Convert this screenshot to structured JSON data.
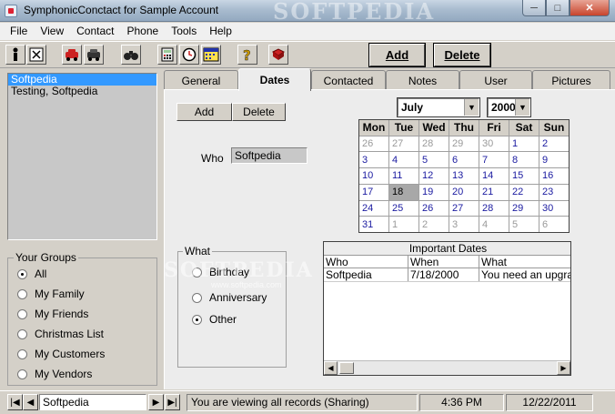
{
  "window": {
    "title": "SymphonicConctact for Sample Account",
    "watermark": "SOFTPEDIA"
  },
  "menu": [
    "File",
    "View",
    "Contact",
    "Phone",
    "Tools",
    "Help"
  ],
  "toolbar": {
    "add_label": "Add",
    "delete_label": "Delete",
    "icons": [
      "person-icon",
      "close-record-icon",
      "car-icon",
      "car-alt-icon",
      "binoculars-icon",
      "calculator-icon",
      "clock-icon",
      "calendar-icon",
      "help-icon",
      "book-icon"
    ]
  },
  "contacts": [
    {
      "name": "Softpedia",
      "selected": true
    },
    {
      "name": "Testing, Softpedia",
      "selected": false
    }
  ],
  "groups": {
    "title": "Your Groups",
    "items": [
      {
        "label": "All",
        "selected": true
      },
      {
        "label": "My Family",
        "selected": false
      },
      {
        "label": "My Friends",
        "selected": false
      },
      {
        "label": "Christmas List",
        "selected": false
      },
      {
        "label": "My Customers",
        "selected": false
      },
      {
        "label": "My Vendors",
        "selected": false
      }
    ]
  },
  "tabs": [
    {
      "label": "General",
      "active": false
    },
    {
      "label": "Dates",
      "active": true
    },
    {
      "label": "Contacted",
      "active": false
    },
    {
      "label": "Notes",
      "active": false
    },
    {
      "label": "User",
      "active": false
    },
    {
      "label": "Pictures",
      "active": false
    }
  ],
  "dates": {
    "add_label": "Add",
    "delete_label": "Delete",
    "who_label": "Who",
    "who_value": "Softpedia",
    "what": {
      "title": "What",
      "options": [
        {
          "label": "Birthday",
          "selected": false
        },
        {
          "label": "Anniversary",
          "selected": false
        },
        {
          "label": "Other",
          "selected": true
        }
      ]
    },
    "month": "July",
    "year": "2000",
    "calendar": {
      "headers": [
        "Mon",
        "Tue",
        "Wed",
        "Thu",
        "Fri",
        "Sat",
        "Sun"
      ],
      "days": [
        {
          "d": "26",
          "other": true
        },
        {
          "d": "27",
          "other": true
        },
        {
          "d": "28",
          "other": true
        },
        {
          "d": "29",
          "other": true
        },
        {
          "d": "30",
          "other": true
        },
        {
          "d": "1"
        },
        {
          "d": "2"
        },
        {
          "d": "3"
        },
        {
          "d": "4"
        },
        {
          "d": "5"
        },
        {
          "d": "6"
        },
        {
          "d": "7"
        },
        {
          "d": "8"
        },
        {
          "d": "9"
        },
        {
          "d": "10"
        },
        {
          "d": "11"
        },
        {
          "d": "12"
        },
        {
          "d": "13"
        },
        {
          "d": "14"
        },
        {
          "d": "15"
        },
        {
          "d": "16"
        },
        {
          "d": "17"
        },
        {
          "d": "18",
          "today": true
        },
        {
          "d": "19"
        },
        {
          "d": "20"
        },
        {
          "d": "21"
        },
        {
          "d": "22"
        },
        {
          "d": "23"
        },
        {
          "d": "24"
        },
        {
          "d": "25"
        },
        {
          "d": "26"
        },
        {
          "d": "27"
        },
        {
          "d": "28"
        },
        {
          "d": "29"
        },
        {
          "d": "30"
        },
        {
          "d": "31"
        },
        {
          "d": "1",
          "other": true
        },
        {
          "d": "2",
          "other": true
        },
        {
          "d": "3",
          "other": true
        },
        {
          "d": "4",
          "other": true
        },
        {
          "d": "5",
          "other": true
        },
        {
          "d": "6",
          "other": true
        }
      ]
    },
    "important": {
      "title": "Important Dates",
      "columns": [
        "Who",
        "When",
        "What"
      ],
      "rows": [
        [
          "Softpedia",
          "7/18/2000",
          "You need an upgrad"
        ]
      ]
    }
  },
  "watermark_url": "www.softpedia.com",
  "status": {
    "current_record": "Softpedia",
    "message": "You are viewing all records   (Sharing)",
    "time": "4:36 PM",
    "date": "12/22/2011"
  }
}
